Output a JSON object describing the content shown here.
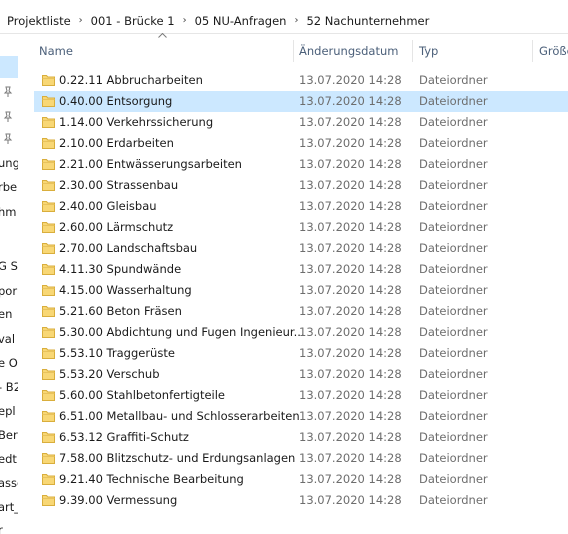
{
  "breadcrumb": [
    "Projektliste",
    "001 - Brücke 1",
    "05 NU-Anfragen",
    "52 Nachunternehmer"
  ],
  "columns": {
    "name": "Name",
    "date": "Änderungsdatum",
    "type": "Typ",
    "size": "Größe"
  },
  "nav_fragments": [
    "ung",
    "rbe",
    "hm",
    "G S",
    "por",
    "en",
    "val",
    "e O",
    "- B2",
    "epl",
    "Berli",
    "edt",
    "asse",
    "art_",
    "r"
  ],
  "icons": {
    "folder": "folder-icon",
    "pin": "pin-icon",
    "sort": "sort-up-icon"
  },
  "colors": {
    "selection": "#cce8ff",
    "folder": "#f8d775"
  },
  "rows": [
    {
      "name": "0.22.11 Abbrucharbeiten",
      "date": "13.07.2020 14:28",
      "type": "Dateiordner"
    },
    {
      "name": "0.40.00 Entsorgung",
      "date": "13.07.2020 14:28",
      "type": "Dateiordner",
      "selected": true
    },
    {
      "name": "1.14.00 Verkehrssicherung",
      "date": "13.07.2020 14:28",
      "type": "Dateiordner"
    },
    {
      "name": "2.10.00 Erdarbeiten",
      "date": "13.07.2020 14:28",
      "type": "Dateiordner"
    },
    {
      "name": "2.21.00 Entwässerungsarbeiten",
      "date": "13.07.2020 14:28",
      "type": "Dateiordner"
    },
    {
      "name": "2.30.00 Strassenbau",
      "date": "13.07.2020 14:28",
      "type": "Dateiordner"
    },
    {
      "name": "2.40.00 Gleisbau",
      "date": "13.07.2020 14:28",
      "type": "Dateiordner"
    },
    {
      "name": "2.60.00 Lärmschutz",
      "date": "13.07.2020 14:28",
      "type": "Dateiordner"
    },
    {
      "name": "2.70.00 Landschaftsbau",
      "date": "13.07.2020 14:28",
      "type": "Dateiordner"
    },
    {
      "name": "4.11.30 Spundwände",
      "date": "13.07.2020 14:28",
      "type": "Dateiordner"
    },
    {
      "name": "4.15.00 Wasserhaltung",
      "date": "13.07.2020 14:28",
      "type": "Dateiordner"
    },
    {
      "name": "5.21.60 Beton Fräsen",
      "date": "13.07.2020 14:28",
      "type": "Dateiordner"
    },
    {
      "name": "5.30.00 Abdichtung und Fugen Ingenieur...",
      "date": "13.07.2020 14:28",
      "type": "Dateiordner"
    },
    {
      "name": "5.53.10 Traggerüste",
      "date": "13.07.2020 14:28",
      "type": "Dateiordner"
    },
    {
      "name": "5.53.20 Verschub",
      "date": "13.07.2020 14:28",
      "type": "Dateiordner"
    },
    {
      "name": "5.60.00 Stahlbetonfertigteile",
      "date": "13.07.2020 14:28",
      "type": "Dateiordner"
    },
    {
      "name": "6.51.00 Metallbau- und Schlosserarbeiten",
      "date": "13.07.2020 14:28",
      "type": "Dateiordner"
    },
    {
      "name": "6.53.12 Graffiti-Schutz",
      "date": "13.07.2020 14:28",
      "type": "Dateiordner"
    },
    {
      "name": "7.58.00 Blitzschutz- und Erdungsanlagen",
      "date": "13.07.2020 14:28",
      "type": "Dateiordner"
    },
    {
      "name": "9.21.40 Technische Bearbeitung",
      "date": "13.07.2020 14:28",
      "type": "Dateiordner"
    },
    {
      "name": "9.39.00 Vermessung",
      "date": "13.07.2020 14:28",
      "type": "Dateiordner"
    }
  ]
}
